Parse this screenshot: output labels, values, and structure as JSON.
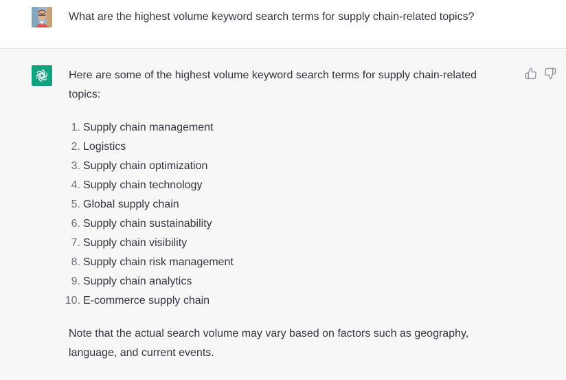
{
  "conversation": {
    "user_message": "What are the highest volume keyword search terms for supply chain-related topics?",
    "assistant_intro": "Here are some of the highest volume keyword search terms for supply chain-related topics:",
    "assistant_list": [
      {
        "num": "1.",
        "text": "Supply chain management"
      },
      {
        "num": "2.",
        "text": "Logistics"
      },
      {
        "num": "3.",
        "text": "Supply chain optimization"
      },
      {
        "num": "4.",
        "text": "Supply chain technology"
      },
      {
        "num": "5.",
        "text": "Global supply chain"
      },
      {
        "num": "6.",
        "text": "Supply chain sustainability"
      },
      {
        "num": "7.",
        "text": "Supply chain visibility"
      },
      {
        "num": "8.",
        "text": "Supply chain risk management"
      },
      {
        "num": "9.",
        "text": "Supply chain analytics"
      },
      {
        "num": "10.",
        "text": "E-commerce supply chain"
      }
    ],
    "assistant_note": "Note that the actual search volume may vary based on factors such as geography, language, and current events."
  },
  "icons": {
    "user_avatar": "user-avatar",
    "assistant_avatar": "openai-logo-icon",
    "thumbs_up": "thumbs-up-icon",
    "thumbs_down": "thumbs-down-icon"
  },
  "colors": {
    "assistant_bg": "#f7f7f8",
    "brand": "#10a37f",
    "text": "#343541"
  }
}
